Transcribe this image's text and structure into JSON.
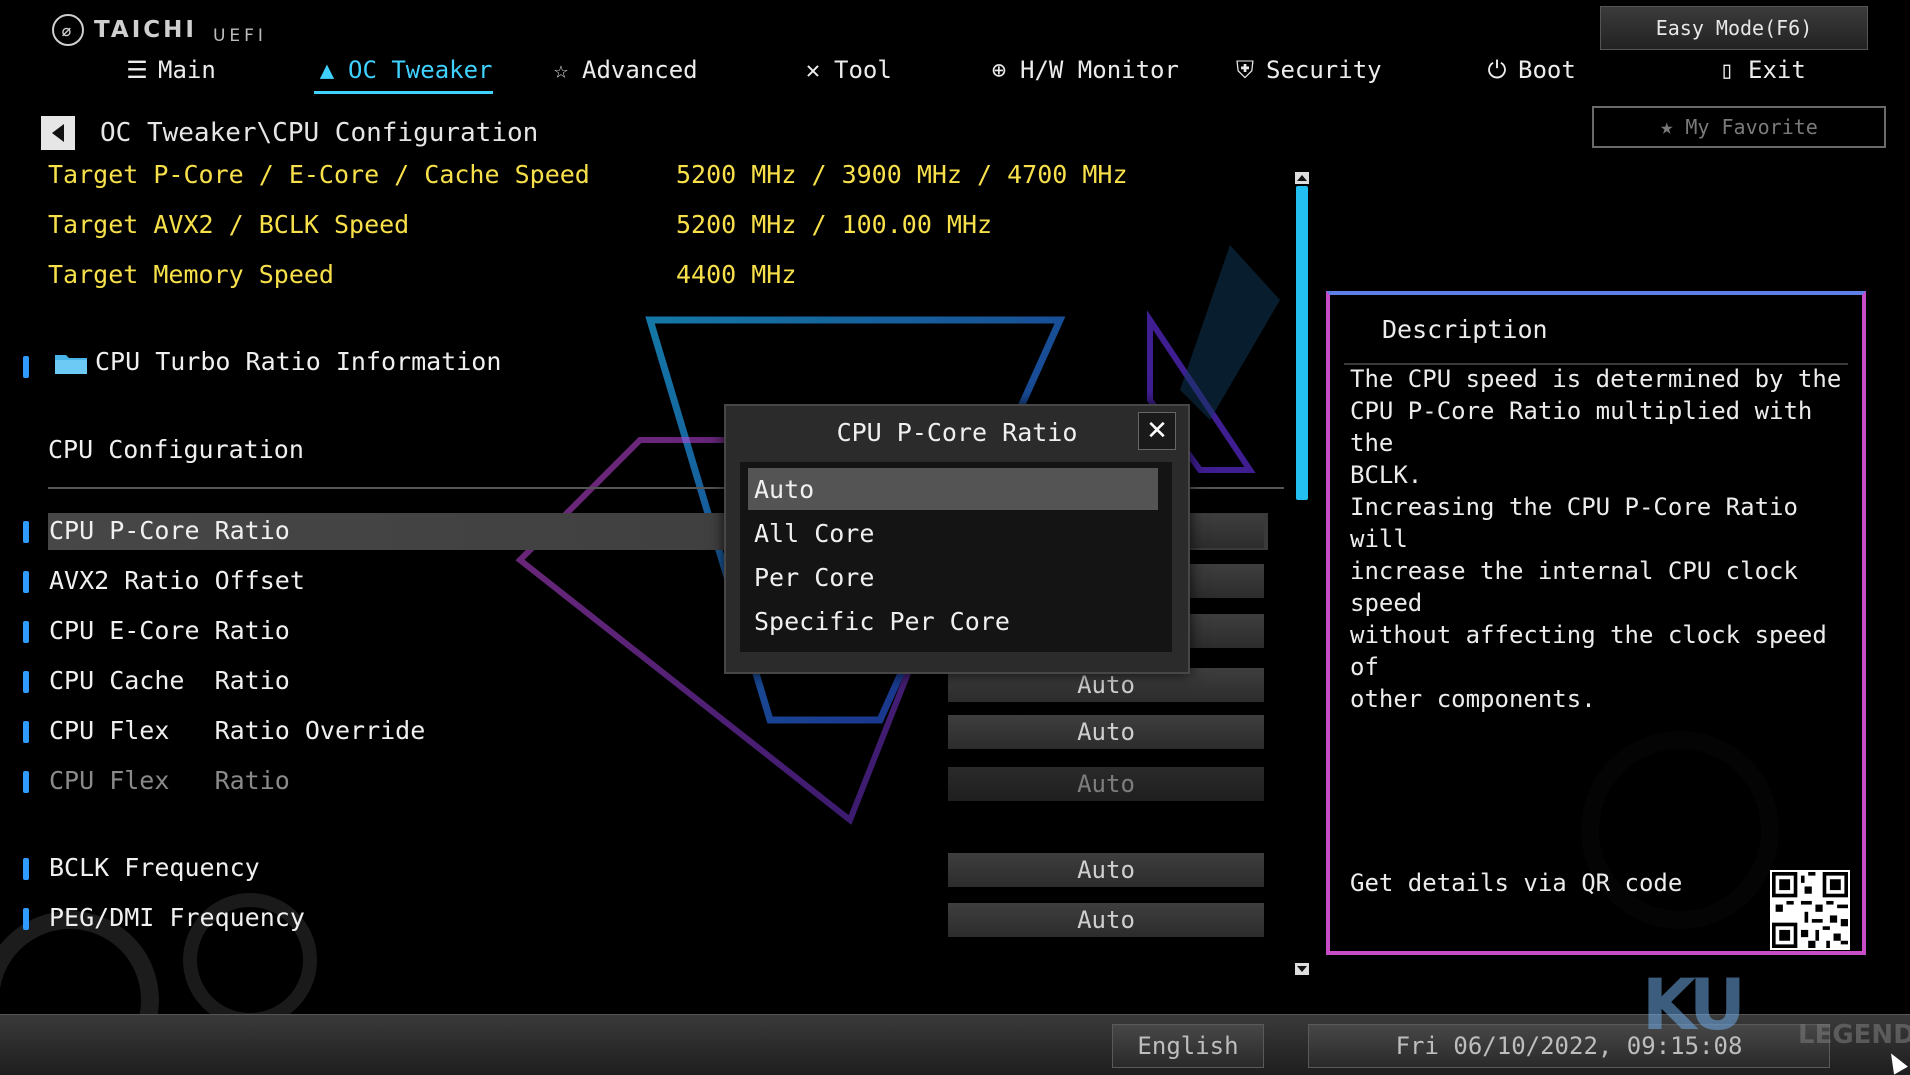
{
  "header": {
    "brand": "TAICHI",
    "uefi": "UEFI",
    "easy_mode": "Easy Mode(F6)",
    "favorite": "My Favorite"
  },
  "nav": [
    {
      "label": "Main",
      "icon": "list-icon"
    },
    {
      "label": "OC Tweaker",
      "icon": "rocket-icon",
      "active": true
    },
    {
      "label": "Advanced",
      "icon": "star-icon"
    },
    {
      "label": "Tool",
      "icon": "wrench-icon"
    },
    {
      "label": "H/W Monitor",
      "icon": "crosshair-icon"
    },
    {
      "label": "Security",
      "icon": "shield-icon"
    },
    {
      "label": "Boot",
      "icon": "power-icon"
    },
    {
      "label": "Exit",
      "icon": "door-icon"
    }
  ],
  "breadcrumb": "OC Tweaker\\CPU Configuration",
  "targets": [
    {
      "label": "Target P-Core / E-Core / Cache Speed",
      "value": "5200 MHz / 3900 MHz / 4700 MHz"
    },
    {
      "label": "Target AVX2 / BCLK Speed",
      "value": "5200 MHz / 100.00 MHz"
    },
    {
      "label": "Target Memory Speed",
      "value": "4400 MHz"
    }
  ],
  "turbo_info": "CPU Turbo Ratio Information",
  "section_title": "CPU Configuration",
  "items": [
    {
      "label": "CPU P-Core Ratio",
      "value": ""
    },
    {
      "label": "AVX2 Ratio Offset",
      "value": ""
    },
    {
      "label": "CPU E-Core Ratio",
      "value": ""
    },
    {
      "label": "CPU Cache  Ratio",
      "value": "Auto"
    },
    {
      "label": "CPU Flex   Ratio Override",
      "value": "Auto"
    },
    {
      "label": "CPU Flex   Ratio",
      "value": "Auto"
    },
    {
      "label": "BCLK Frequency",
      "value": "Auto"
    },
    {
      "label": "PEG/DMI Frequency",
      "value": "Auto"
    }
  ],
  "popup": {
    "title": "CPU P-Core Ratio",
    "options": [
      "Auto",
      "All Core",
      "Per Core",
      "Specific Per Core"
    ],
    "selected_index": 0
  },
  "description": {
    "title": "Description",
    "text": "The CPU speed is determined by the\nCPU P-Core Ratio multiplied with the\nBCLK.\nIncreasing the CPU P-Core Ratio will\nincrease the internal CPU clock speed\nwithout affecting the clock speed of\nother components.",
    "qr_text": "Get details via QR code"
  },
  "status": {
    "language": "English",
    "datetime": "Fri 06/10/2022, 09:15:08"
  },
  "watermark": {
    "logo": "KU",
    "text": "LEGEND"
  },
  "colors": {
    "accent": "#3fd2ff",
    "target_text": "#f7e04a",
    "bullet": "#2f9bff",
    "panel_border": "#c64cc8"
  }
}
